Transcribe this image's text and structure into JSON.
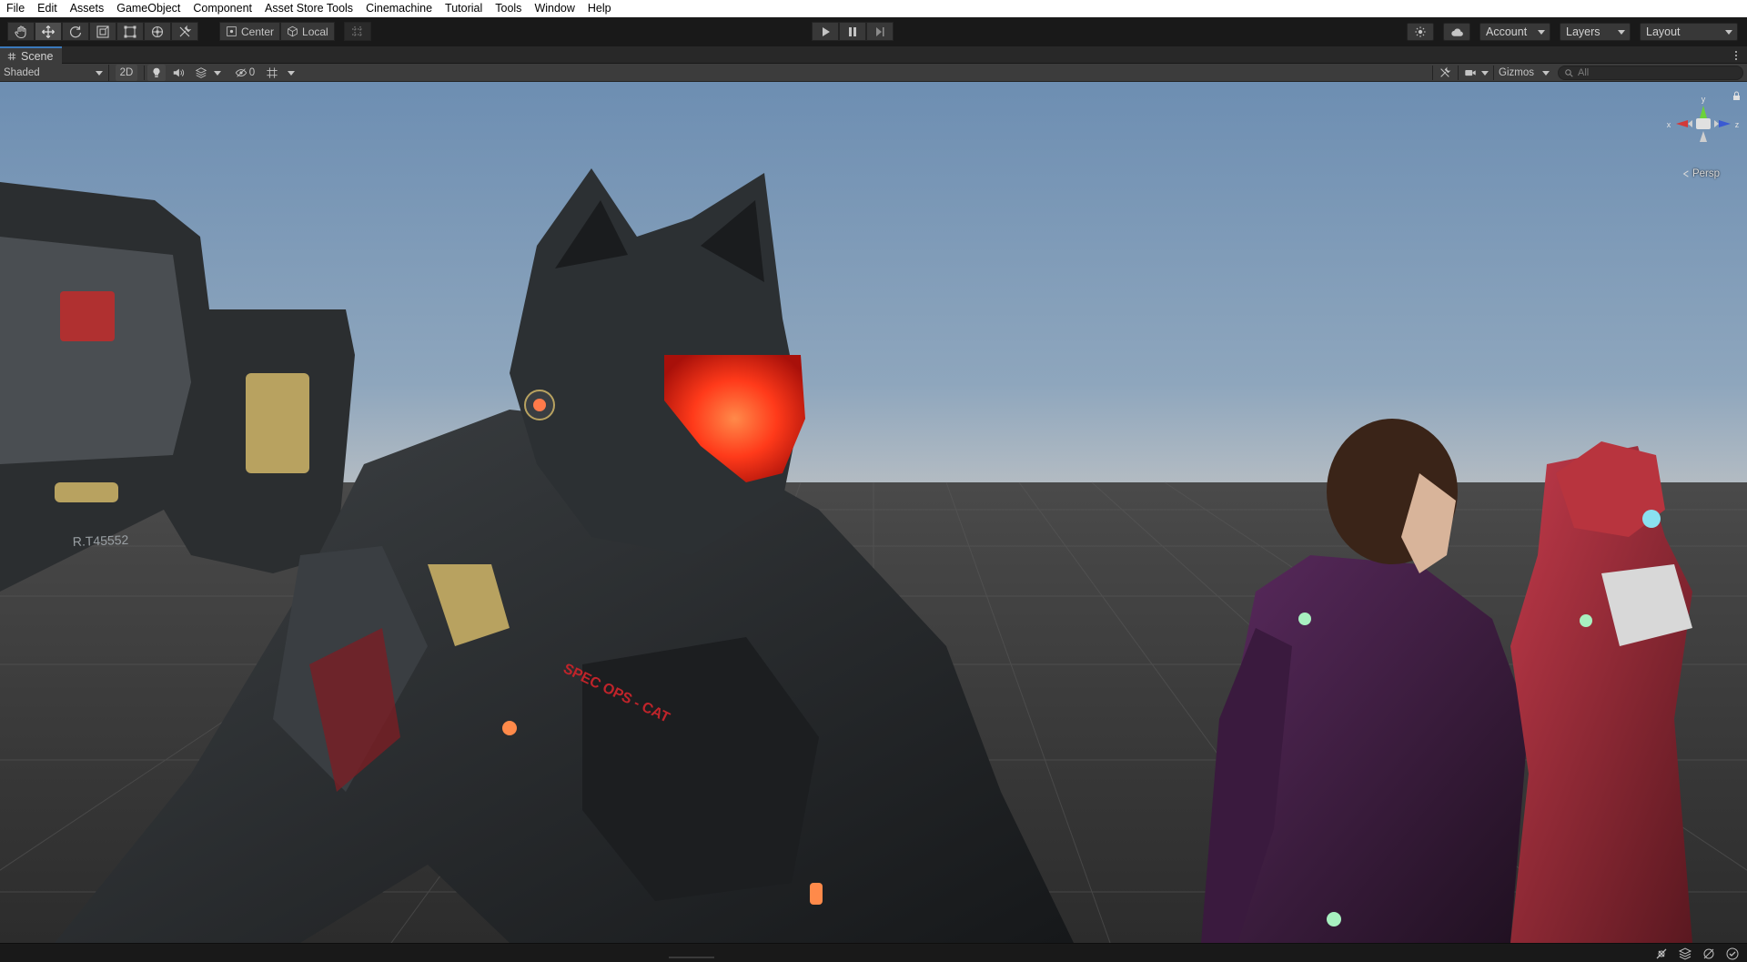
{
  "menu": [
    "File",
    "Edit",
    "Assets",
    "GameObject",
    "Component",
    "Asset Store Tools",
    "Cinemachine",
    "Tutorial",
    "Tools",
    "Window",
    "Help"
  ],
  "toolbar": {
    "tools": [
      "hand-tool-icon",
      "move-tool-icon",
      "rotate-tool-icon",
      "scale-tool-icon",
      "rect-tool-icon",
      "transform-tool-icon",
      "custom-tool-icon"
    ],
    "active_tool": "move-tool-icon",
    "pivot_label": "Center",
    "space_label": "Local",
    "account_label": "Account",
    "layers_label": "Layers",
    "layout_label": "Layout"
  },
  "scene_tab": {
    "label": "Scene"
  },
  "scene_toolbar": {
    "draw_mode": "Shaded",
    "mode_2d": "2D",
    "hidden_count": "0",
    "gizmos_label": "Gizmos",
    "search_placeholder": "All"
  },
  "view_gizmo": {
    "y": "y",
    "x": "x",
    "z": "z",
    "projection": "Persp"
  },
  "scene_content": {
    "suit_text": "SPEC OPS - CAT",
    "gun_text": "R.T45552"
  },
  "colors": {
    "accent": "#3a79bb",
    "visor": "#ff3a1a",
    "axis_x": "#d23a3a",
    "axis_y": "#6bd23a",
    "axis_z": "#3a5ad2"
  }
}
